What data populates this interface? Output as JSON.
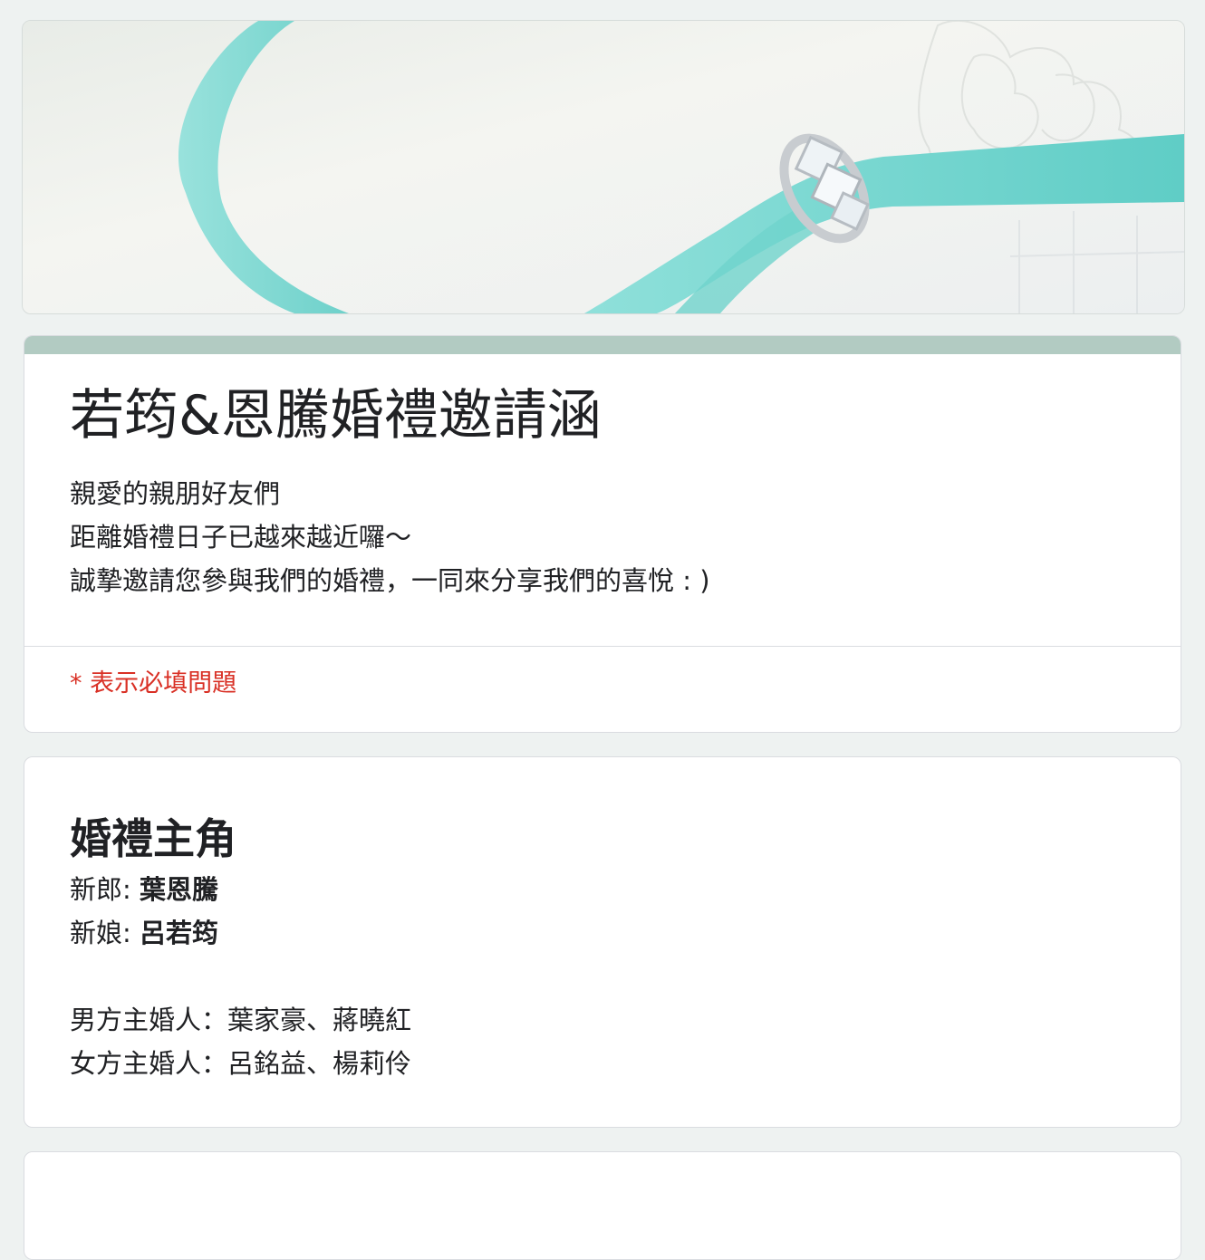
{
  "banner": {
    "image_label": "wedding-ring-ribbon-banner"
  },
  "header": {
    "title": "若筠&恩騰婚禮邀請涵",
    "description_lines": [
      "親愛的親朋好友們",
      "距離婚禮日子已越來越近囉～",
      "誠摯邀請您參與我們的婚禮，一同來分享我們的喜悅 : )"
    ],
    "required_note": "* 表示必填問題",
    "accent_color": "#b2cbc2"
  },
  "section": {
    "title": "婚禮主角",
    "groom_label": "新郎: ",
    "groom_name": "葉恩騰",
    "bride_label": "新娘: ",
    "bride_name": "呂若筠",
    "groom_hosts": "男方主婚人：葉家豪、蔣曉紅",
    "bride_hosts": "女方主婚人：呂銘益、楊莉伶"
  },
  "colors": {
    "page_background": "#eef2f1",
    "required_red": "#d93025",
    "ribbon": "#7fd9d3"
  }
}
